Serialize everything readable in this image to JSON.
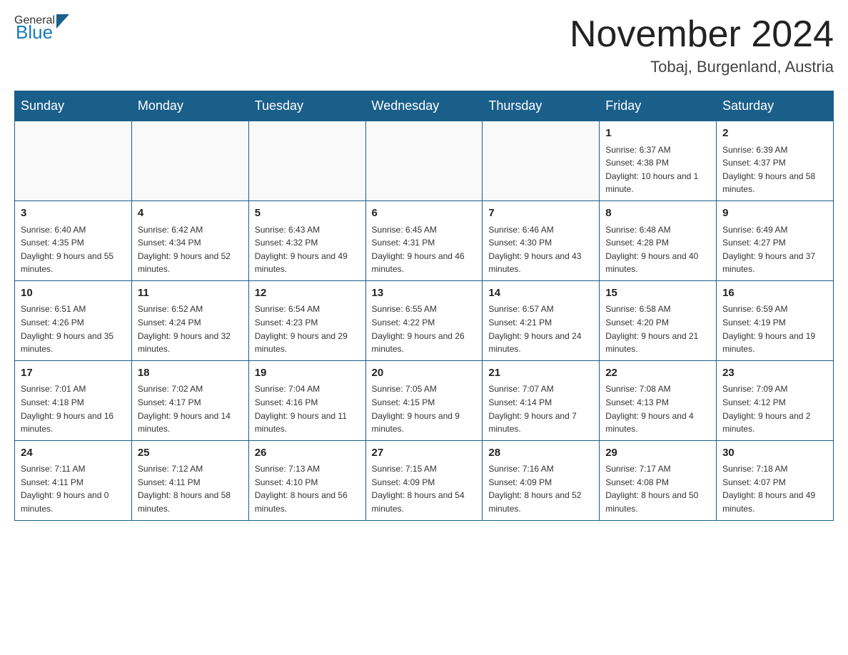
{
  "header": {
    "logo_general": "General",
    "logo_blue": "Blue",
    "month_title": "November 2024",
    "location": "Tobaj, Burgenland, Austria"
  },
  "days_of_week": [
    "Sunday",
    "Monday",
    "Tuesday",
    "Wednesday",
    "Thursday",
    "Friday",
    "Saturday"
  ],
  "weeks": [
    [
      {
        "day": "",
        "info": ""
      },
      {
        "day": "",
        "info": ""
      },
      {
        "day": "",
        "info": ""
      },
      {
        "day": "",
        "info": ""
      },
      {
        "day": "",
        "info": ""
      },
      {
        "day": "1",
        "info": "Sunrise: 6:37 AM\nSunset: 4:38 PM\nDaylight: 10 hours and 1 minute."
      },
      {
        "day": "2",
        "info": "Sunrise: 6:39 AM\nSunset: 4:37 PM\nDaylight: 9 hours and 58 minutes."
      }
    ],
    [
      {
        "day": "3",
        "info": "Sunrise: 6:40 AM\nSunset: 4:35 PM\nDaylight: 9 hours and 55 minutes."
      },
      {
        "day": "4",
        "info": "Sunrise: 6:42 AM\nSunset: 4:34 PM\nDaylight: 9 hours and 52 minutes."
      },
      {
        "day": "5",
        "info": "Sunrise: 6:43 AM\nSunset: 4:32 PM\nDaylight: 9 hours and 49 minutes."
      },
      {
        "day": "6",
        "info": "Sunrise: 6:45 AM\nSunset: 4:31 PM\nDaylight: 9 hours and 46 minutes."
      },
      {
        "day": "7",
        "info": "Sunrise: 6:46 AM\nSunset: 4:30 PM\nDaylight: 9 hours and 43 minutes."
      },
      {
        "day": "8",
        "info": "Sunrise: 6:48 AM\nSunset: 4:28 PM\nDaylight: 9 hours and 40 minutes."
      },
      {
        "day": "9",
        "info": "Sunrise: 6:49 AM\nSunset: 4:27 PM\nDaylight: 9 hours and 37 minutes."
      }
    ],
    [
      {
        "day": "10",
        "info": "Sunrise: 6:51 AM\nSunset: 4:26 PM\nDaylight: 9 hours and 35 minutes."
      },
      {
        "day": "11",
        "info": "Sunrise: 6:52 AM\nSunset: 4:24 PM\nDaylight: 9 hours and 32 minutes."
      },
      {
        "day": "12",
        "info": "Sunrise: 6:54 AM\nSunset: 4:23 PM\nDaylight: 9 hours and 29 minutes."
      },
      {
        "day": "13",
        "info": "Sunrise: 6:55 AM\nSunset: 4:22 PM\nDaylight: 9 hours and 26 minutes."
      },
      {
        "day": "14",
        "info": "Sunrise: 6:57 AM\nSunset: 4:21 PM\nDaylight: 9 hours and 24 minutes."
      },
      {
        "day": "15",
        "info": "Sunrise: 6:58 AM\nSunset: 4:20 PM\nDaylight: 9 hours and 21 minutes."
      },
      {
        "day": "16",
        "info": "Sunrise: 6:59 AM\nSunset: 4:19 PM\nDaylight: 9 hours and 19 minutes."
      }
    ],
    [
      {
        "day": "17",
        "info": "Sunrise: 7:01 AM\nSunset: 4:18 PM\nDaylight: 9 hours and 16 minutes."
      },
      {
        "day": "18",
        "info": "Sunrise: 7:02 AM\nSunset: 4:17 PM\nDaylight: 9 hours and 14 minutes."
      },
      {
        "day": "19",
        "info": "Sunrise: 7:04 AM\nSunset: 4:16 PM\nDaylight: 9 hours and 11 minutes."
      },
      {
        "day": "20",
        "info": "Sunrise: 7:05 AM\nSunset: 4:15 PM\nDaylight: 9 hours and 9 minutes."
      },
      {
        "day": "21",
        "info": "Sunrise: 7:07 AM\nSunset: 4:14 PM\nDaylight: 9 hours and 7 minutes."
      },
      {
        "day": "22",
        "info": "Sunrise: 7:08 AM\nSunset: 4:13 PM\nDaylight: 9 hours and 4 minutes."
      },
      {
        "day": "23",
        "info": "Sunrise: 7:09 AM\nSunset: 4:12 PM\nDaylight: 9 hours and 2 minutes."
      }
    ],
    [
      {
        "day": "24",
        "info": "Sunrise: 7:11 AM\nSunset: 4:11 PM\nDaylight: 9 hours and 0 minutes."
      },
      {
        "day": "25",
        "info": "Sunrise: 7:12 AM\nSunset: 4:11 PM\nDaylight: 8 hours and 58 minutes."
      },
      {
        "day": "26",
        "info": "Sunrise: 7:13 AM\nSunset: 4:10 PM\nDaylight: 8 hours and 56 minutes."
      },
      {
        "day": "27",
        "info": "Sunrise: 7:15 AM\nSunset: 4:09 PM\nDaylight: 8 hours and 54 minutes."
      },
      {
        "day": "28",
        "info": "Sunrise: 7:16 AM\nSunset: 4:09 PM\nDaylight: 8 hours and 52 minutes."
      },
      {
        "day": "29",
        "info": "Sunrise: 7:17 AM\nSunset: 4:08 PM\nDaylight: 8 hours and 50 minutes."
      },
      {
        "day": "30",
        "info": "Sunrise: 7:18 AM\nSunset: 4:07 PM\nDaylight: 8 hours and 49 minutes."
      }
    ]
  ]
}
